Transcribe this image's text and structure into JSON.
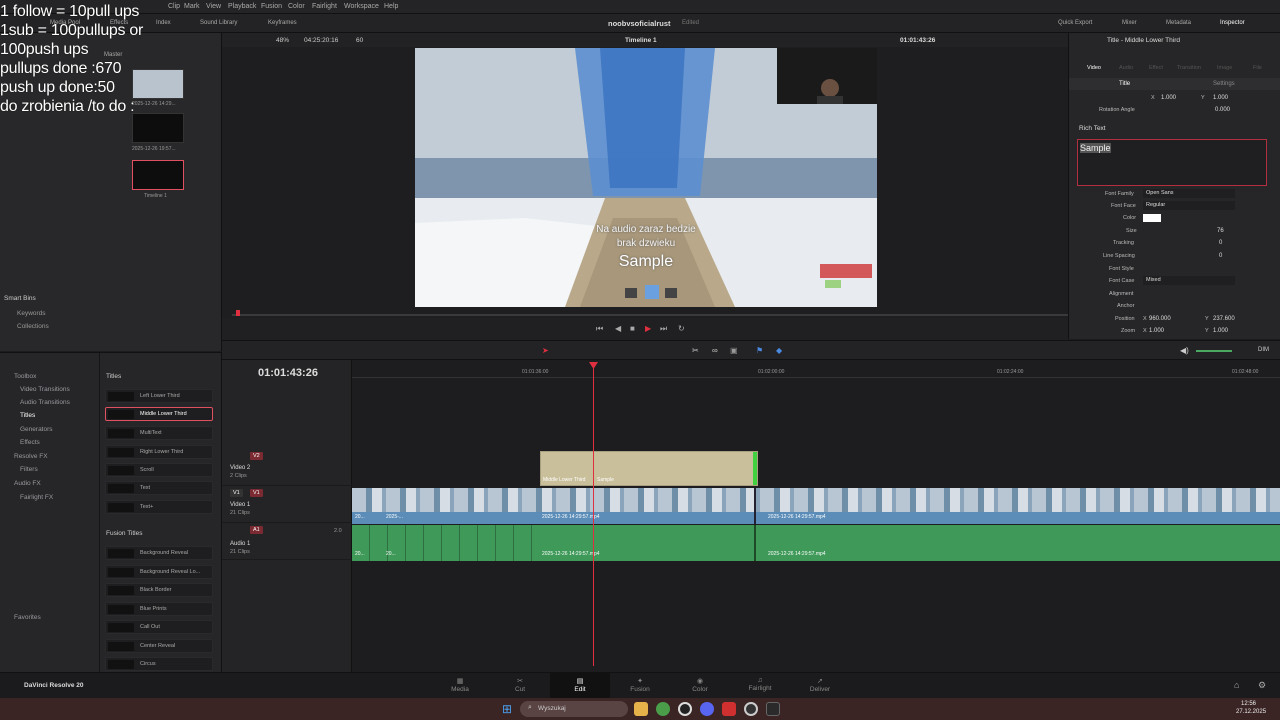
{
  "overlay": {
    "lines": [
      "1 follow = 10pull ups",
      "1sub = 100pullups or",
      "100push ups",
      "pullups done :670",
      "push up done:50",
      "do zrobienia /to do :"
    ]
  },
  "menubar": {
    "items": [
      "Clip",
      "Mark",
      "View",
      "Playback",
      "Fusion",
      "Color",
      "Fairlight",
      "Workspace",
      "Help"
    ],
    "project_name": "noobvsoficialrust",
    "project_status": "Edited"
  },
  "toolbar": {
    "left_items": [
      "Media Pool",
      "Effects",
      "Index",
      "Sound Library",
      "Keyframes"
    ],
    "right_items": [
      "Quick Export",
      "Mixer",
      "Metadata",
      "Inspector"
    ]
  },
  "viewer": {
    "zoom": "48%",
    "source_timecode": "04:25:20:16",
    "frame_count": "60",
    "timeline_name": "Timeline 1",
    "record_timecode": "01:01:43:26",
    "video_caption_line1": "Na audio zaraz bedzie",
    "video_caption_line2": "brak dzwieku",
    "video_caption_sample": "Sample"
  },
  "mediapool": {
    "master_label": "Master",
    "clips": [
      {
        "date": "2025-12-26 14:29..."
      },
      {
        "date": "2025-12-26 19:57..."
      },
      {
        "date": "Timeline 1"
      }
    ]
  },
  "smartbins": {
    "title": "Smart Bins",
    "items": [
      "Keywords",
      "Collections"
    ]
  },
  "effects_tree": {
    "items": [
      {
        "label": "Toolbox",
        "indent": 0
      },
      {
        "label": "Video Transitions",
        "indent": 1
      },
      {
        "label": "Audio Transitions",
        "indent": 1
      },
      {
        "label": "Titles",
        "indent": 1
      },
      {
        "label": "Generators",
        "indent": 1
      },
      {
        "label": "Effects",
        "indent": 1
      },
      {
        "label": "Resolve FX",
        "indent": 0
      },
      {
        "label": "Filters",
        "indent": 1
      },
      {
        "label": "Audio FX",
        "indent": 0
      },
      {
        "label": "Fairlight FX",
        "indent": 1
      }
    ],
    "favorites": "Favorites"
  },
  "effects_list": {
    "titles_header": "Titles",
    "titles": [
      "Left Lower Third",
      "Middle Lower Third",
      "MultiText",
      "Right Lower Third",
      "Scroll",
      "Text",
      "Text+"
    ],
    "fusion_header": "Fusion Titles",
    "fusion_titles": [
      "Background Reveal",
      "Background Reveal Lo...",
      "Black Border",
      "Blue Prints",
      "Call Out",
      "Center Reveal",
      "Circus"
    ]
  },
  "inspector": {
    "title": "Title - Middle Lower Third",
    "tabs": [
      "Video",
      "Audio",
      "Effect",
      "Transition",
      "Image",
      "File"
    ],
    "subtabs": [
      "Title",
      "Settings"
    ],
    "zoom_x": "1.000",
    "zoom_y": "1.000",
    "rotation_label": "Rotation Angle",
    "rotation_value": "0.000",
    "rich_text_label": "Rich Text",
    "rich_text_value": "Sample",
    "font_family_label": "Font Family",
    "font_family": "Open Sans",
    "font_face_label": "Font Face",
    "font_face": "Regular",
    "color_label": "Color",
    "size_label": "Size",
    "size_value": "76",
    "tracking_label": "Tracking",
    "tracking_value": "0",
    "line_spacing_label": "Line Spacing",
    "line_spacing_value": "0",
    "font_style_label": "Font Style",
    "font_case_label": "Font Case",
    "font_case": "Mixed",
    "alignment_label": "Alignment",
    "anchor_label": "Anchor",
    "position_label": "Position",
    "position_x": "960.000",
    "position_y": "237.600",
    "zoom_label": "Zoom",
    "zoom2_x": "1.000",
    "zoom2_y": "1.000",
    "x_label": "X",
    "y_label": "Y"
  },
  "timeline": {
    "timecode": "01:01:43:26",
    "ruler": [
      "01:01:36:00",
      "01:02:00:00",
      "01:02:24:00",
      "01:02:48:00"
    ],
    "dim_label": "DIM",
    "tracks": [
      {
        "id": "V2",
        "name": "Video 2",
        "clips": "2 Clips"
      },
      {
        "id": "V1",
        "name": "Video 1",
        "clips": "21 Clips"
      },
      {
        "id": "A1",
        "name": "Audio 1",
        "clips": "21 Clips",
        "level": "2.0"
      }
    ],
    "title_clip_label": "Middle Lower Third",
    "title_clip_sample": "Sample",
    "clip_name_a": "2025-12-26 14:29:57.mp4",
    "clip_name_b": "2025-12-26 14:29:57.mp4",
    "short_labels": [
      "20...",
      "2025-...",
      "20...",
      "20..."
    ]
  },
  "pagebar": {
    "app_name": "DaVinci Resolve 20",
    "tabs": [
      "Media",
      "Cut",
      "Edit",
      "Fusion",
      "Color",
      "Fairlight",
      "Deliver"
    ],
    "active": "Edit"
  },
  "taskbar": {
    "search_placeholder": "Wyszukaj",
    "time": "12:56",
    "date": "27.12.2025"
  },
  "colors": {
    "accent_red": "#e05060",
    "playhead": "#e03040",
    "v1_clip": "#5b8db8",
    "a1_clip": "#3f9a5a",
    "title_clip": "#c9bf9b"
  }
}
